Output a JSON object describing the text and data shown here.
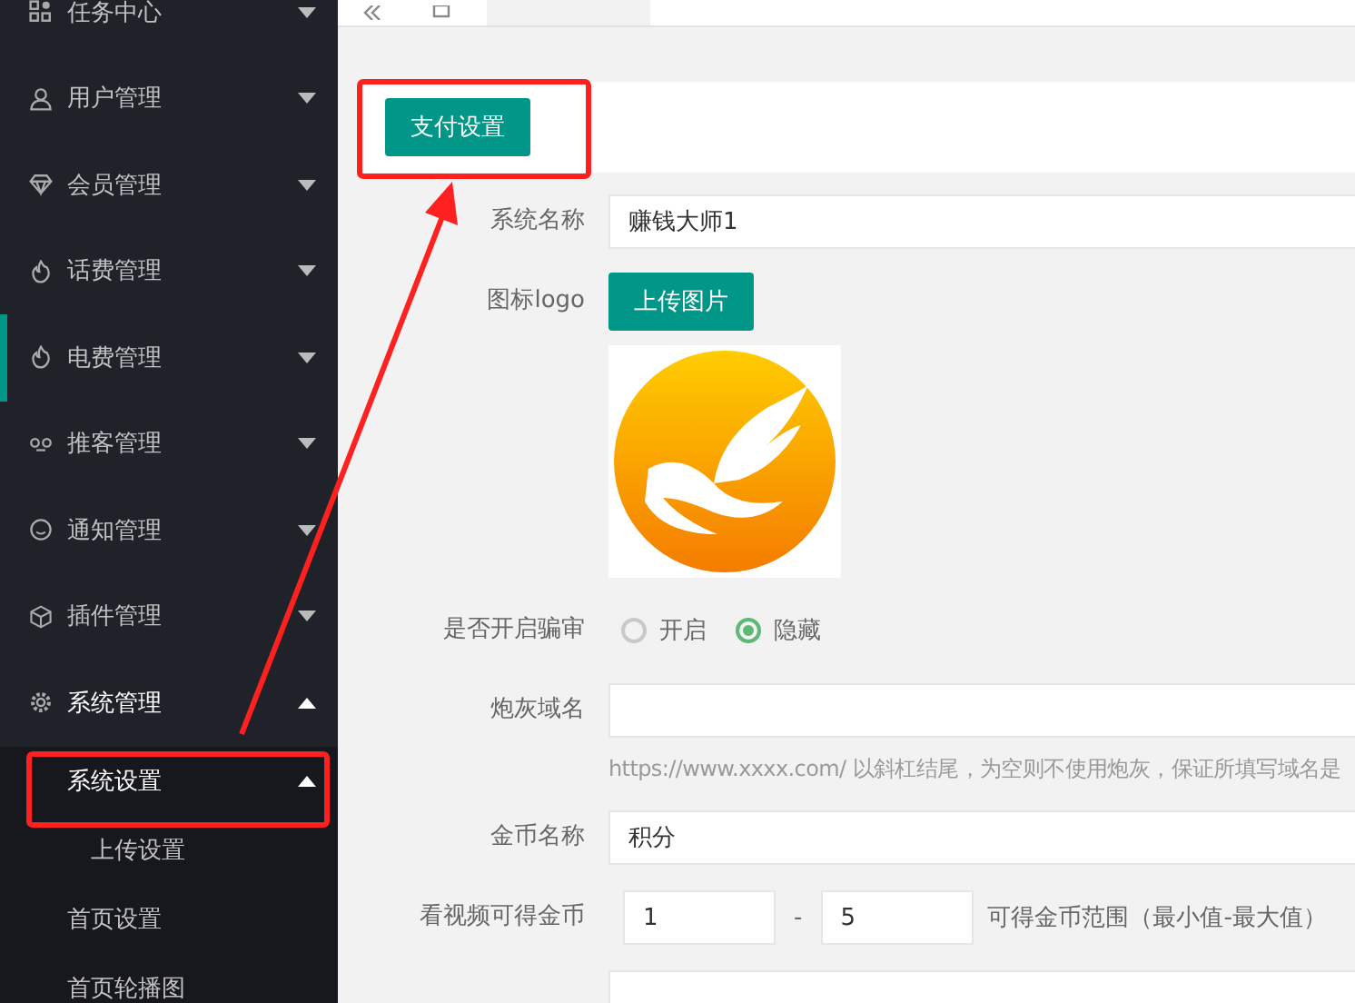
{
  "sidebar": {
    "items": [
      {
        "label": "任务中心",
        "selected": false,
        "expanded": false
      },
      {
        "label": "用户管理",
        "selected": false,
        "expanded": false
      },
      {
        "label": "会员管理",
        "selected": false,
        "expanded": false
      },
      {
        "label": "话费管理",
        "selected": false,
        "expanded": false
      },
      {
        "label": "电费管理",
        "selected": true,
        "expanded": false
      },
      {
        "label": "推客管理",
        "selected": false,
        "expanded": false
      },
      {
        "label": "通知管理",
        "selected": false,
        "expanded": false
      },
      {
        "label": "插件管理",
        "selected": false,
        "expanded": false
      },
      {
        "label": "系统管理",
        "selected": false,
        "expanded": true,
        "children": [
          {
            "label": "系统设置",
            "expanded": true,
            "children": [
              {
                "label": "上传设置"
              }
            ]
          },
          {
            "label": "首页设置"
          },
          {
            "label": "首页轮播图"
          }
        ]
      }
    ]
  },
  "toolbar": {
    "pay_button": "支付设置"
  },
  "form": {
    "rows": [
      {
        "kind": "text",
        "label": "系统名称",
        "value": "赚钱大师1"
      },
      {
        "kind": "upload",
        "label": "图标logo",
        "button": "上传图片"
      },
      {
        "kind": "radio",
        "label": "是否开启骗审",
        "options": [
          {
            "label": "开启",
            "selected": false
          },
          {
            "label": "隐藏",
            "selected": true
          }
        ]
      },
      {
        "kind": "text",
        "label": "炮灰域名",
        "value": "",
        "hint": "https://www.xxxx.com/ 以斜杠结尾，为空则不使用炮灰，保证所填写域名是"
      },
      {
        "kind": "text",
        "label": "金币名称",
        "value": "积分"
      },
      {
        "kind": "range",
        "label": "看视频可得金币",
        "min": "1",
        "separator": "-",
        "max": "5",
        "note": "可得金币范围（最小值-最大值）"
      },
      {
        "kind": "text",
        "label": "",
        "value": ""
      }
    ]
  }
}
